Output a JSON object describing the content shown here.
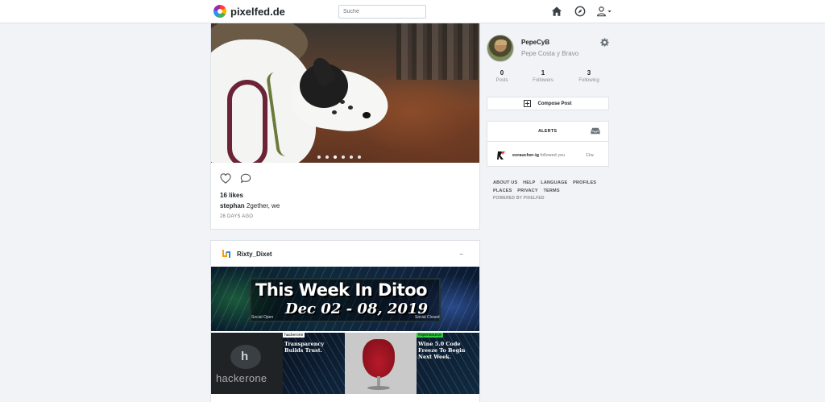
{
  "brand": {
    "name": "pixelfed.de"
  },
  "search": {
    "placeholder": "Suche"
  },
  "post1": {
    "likes": "16 likes",
    "caption_user": "stephan",
    "caption_text": "2gether, we",
    "time": "28 DAYS AGO"
  },
  "post2": {
    "username": "Rixty_Dixet",
    "more": "...",
    "banner": {
      "title": "This Week In Ditoo",
      "date": "Dec 02 - 08, 2019",
      "left_label": "Social Open",
      "right_label": "Social Closed"
    },
    "tiles": {
      "t1_tag": "hackerone",
      "t1_text": "Transparency Builds Trust.",
      "t1_logo": "hackerone",
      "t2_tag": "#opensource",
      "t2_text": "Wine 5.0 Code Freeze To Begin Next Week."
    }
  },
  "profile": {
    "username": "PepeCyB",
    "display_name": "Pepe Costa y Bravo",
    "stats": [
      {
        "value": "0",
        "label": "Posts"
      },
      {
        "value": "1",
        "label": "Followers"
      },
      {
        "value": "3",
        "label": "Following"
      }
    ]
  },
  "compose": {
    "label": "Compose Post"
  },
  "alerts": {
    "title": "ALERTS",
    "items": [
      {
        "user": "exraucher-ig",
        "text": "followed you",
        "time": "11w"
      }
    ]
  },
  "footer": {
    "links": [
      "ABOUT US",
      "HELP",
      "LANGUAGE",
      "PROFILES",
      "PLACES",
      "PRIVACY",
      "TERMS"
    ],
    "powered": "POWERED BY PIXELFED"
  },
  "colors": {
    "accent": "#1da1f2",
    "bg": "#f1f3f6",
    "muted": "#8b9196"
  },
  "icons": [
    "home-icon",
    "explore-compass-icon",
    "user-menu-icon",
    "heart-icon",
    "comment-icon",
    "gear-icon",
    "inbox-icon",
    "compose-plus-icon"
  ]
}
